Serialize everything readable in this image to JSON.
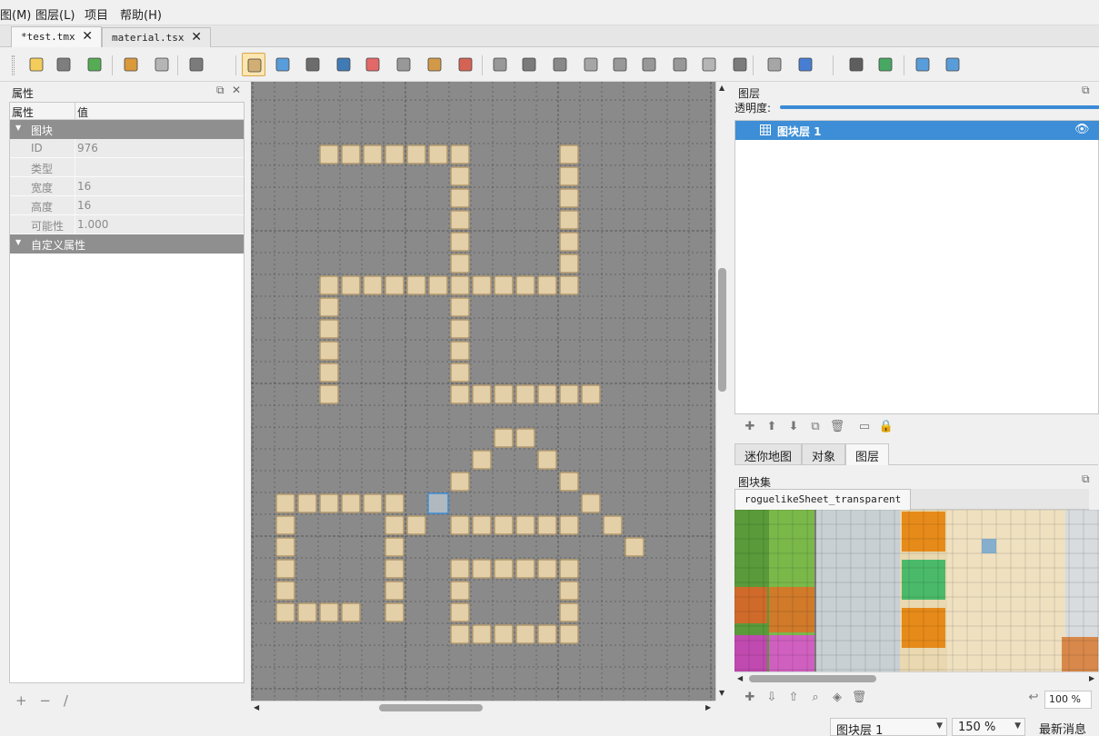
{
  "menubar": {
    "items": [
      "图(M)",
      "图层(L)",
      "项目",
      "帮助(H)"
    ]
  },
  "doc_tabs": [
    {
      "label": "*test.tmx",
      "close": "✕"
    },
    {
      "label": "material.tsx",
      "close": "✕"
    }
  ],
  "toolbar": {
    "icons": [
      "new-map-icon",
      "open-icon",
      "save-icon",
      "undo-icon",
      "redo-icon",
      "commands-icon",
      "stamp-brush-icon",
      "terrain-brush-icon",
      "bucket-fill-icon",
      "shape-fill-icon",
      "eraser-icon",
      "rect-select-icon",
      "magic-wand-icon",
      "select-same-tile-icon",
      "select-objects-icon",
      "edit-polygons-icon",
      "insert-rectangle-icon",
      "insert-point-icon",
      "insert-ellipse-icon",
      "insert-polygon-icon",
      "insert-tile-icon",
      "insert-template-icon",
      "insert-text-icon",
      "random-mode-icon",
      "wang-fill-icon",
      "flip-horizontal-icon",
      "flip-vertical-icon",
      "rotate-left-icon",
      "rotate-right-icon"
    ]
  },
  "properties": {
    "title": "属性",
    "col_name": "属性",
    "col_value": "值",
    "group_tile": "图块",
    "rows": [
      {
        "key": "ID",
        "value": "976"
      },
      {
        "key": "类型",
        "value": ""
      },
      {
        "key": "宽度",
        "value": "16"
      },
      {
        "key": "高度",
        "value": "16"
      },
      {
        "key": "可能性",
        "value": "1.000"
      }
    ],
    "group_custom": "自定义属性",
    "footer": {
      "add": "+",
      "remove": "−",
      "rename": "/"
    }
  },
  "layers": {
    "title": "图层",
    "opacity_label": "透明度:",
    "opacity_value": 1.0,
    "items": [
      {
        "name": "图块层 1",
        "visible": true,
        "selected": true
      }
    ],
    "tabs": [
      "迷你地图",
      "对象",
      "图层"
    ],
    "active_tab": "图层"
  },
  "tilesets": {
    "title": "图块集",
    "tab": "roguelikeSheet_transparent",
    "zoom": "100 %"
  },
  "statusbar": {
    "layer": "图块层 1",
    "zoom": "150 %",
    "news": "最新消息"
  },
  "colors": {
    "accent": "#3d8ed6",
    "map_bg": "#8a8a8a",
    "tile": "#e3cfa8",
    "group_header": "#8f8f8f"
  }
}
